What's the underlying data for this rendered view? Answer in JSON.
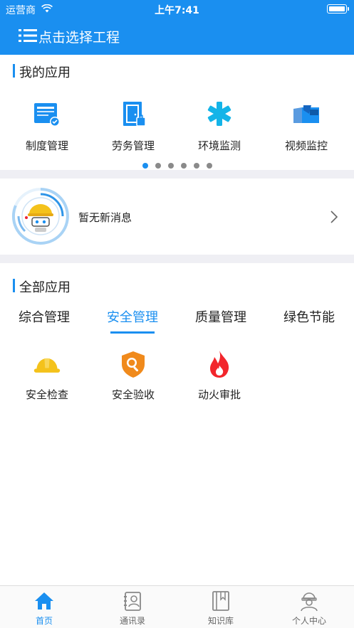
{
  "status_bar": {
    "carrier": "运营商",
    "time": "上午7:41"
  },
  "nav": {
    "title": "点击选择工程"
  },
  "my_apps": {
    "title": "我的应用",
    "items": [
      {
        "label": "制度管理",
        "icon": "document-icon"
      },
      {
        "label": "劳务管理",
        "icon": "door-icon"
      },
      {
        "label": "环境监测",
        "icon": "asterisk-icon"
      },
      {
        "label": "视频监控",
        "icon": "camera-icon"
      }
    ],
    "pager": {
      "pages": 6,
      "active": 1
    }
  },
  "message": {
    "text": "暂无新消息"
  },
  "all_apps": {
    "title": "全部应用",
    "tabs": [
      "综合管理",
      "安全管理",
      "质量管理",
      "绿色节能"
    ],
    "active_tab": 1,
    "items": [
      {
        "label": "安全检查",
        "icon": "helmet-icon"
      },
      {
        "label": "安全验收",
        "icon": "shield-search-icon"
      },
      {
        "label": "动火审批",
        "icon": "fire-icon"
      }
    ]
  },
  "tabbar": {
    "items": [
      {
        "label": "首页",
        "icon": "home-icon"
      },
      {
        "label": "通讯录",
        "icon": "contacts-icon"
      },
      {
        "label": "知识库",
        "icon": "book-icon"
      },
      {
        "label": "个人中心",
        "icon": "worker-icon"
      }
    ],
    "active": 0
  },
  "colors": {
    "primary": "#1a8ff0",
    "separator": "#efeff4",
    "icon_cyan": "#14b4e8",
    "icon_yellow": "#f4c21b",
    "icon_orange": "#f08a1c",
    "icon_red": "#f2262c"
  }
}
